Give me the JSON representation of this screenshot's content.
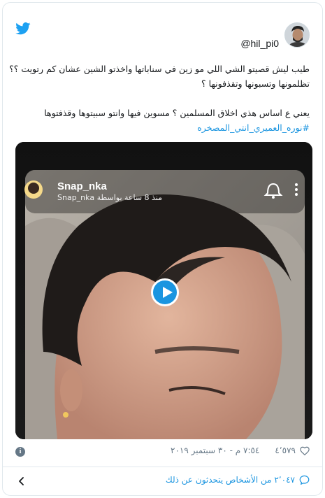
{
  "author": {
    "handle": "@hil_pi0"
  },
  "tweet": {
    "line1": "طيب ليش قصيتو الشي اللي مو زين في سناباتها واخذتو الشين عشان كم رتويت ؟؟",
    "line2": "تظلمونها وتسبونها وتقذفونها ؟",
    "line3": "يعني ع اساس هذي اخلاق المسلمين ؟ مسوين فيها وانتو سبيتوها وقذفتوها",
    "hashtag": "#نوره_العميري_انتي_المصخره"
  },
  "media": {
    "snap_name": "Snap_nka",
    "snap_sub": "Snap_nka منذ 8 ساعة بواسطة"
  },
  "meta": {
    "likes": "٤٬٥٧٩",
    "timestamp": "٧:٥٤ م - ٣٠ سبتمبر ٢٠١٩",
    "info_symbol": "i"
  },
  "footer": {
    "conversation_label": "٢٬٠٤٧ من الأشخاص يتحدثون عن ذلك"
  },
  "colors": {
    "accent": "#1b95e0",
    "muted": "#657786",
    "border": "#e1e8ed"
  },
  "icons": {
    "brand": "twitter-bird-icon",
    "like": "heart-icon",
    "info": "info-icon",
    "conversation": "speech-bubble-icon",
    "chevron": "chevron-left-icon",
    "play": "play-icon",
    "bell": "bell-icon",
    "menu": "more-vertical-icon"
  }
}
